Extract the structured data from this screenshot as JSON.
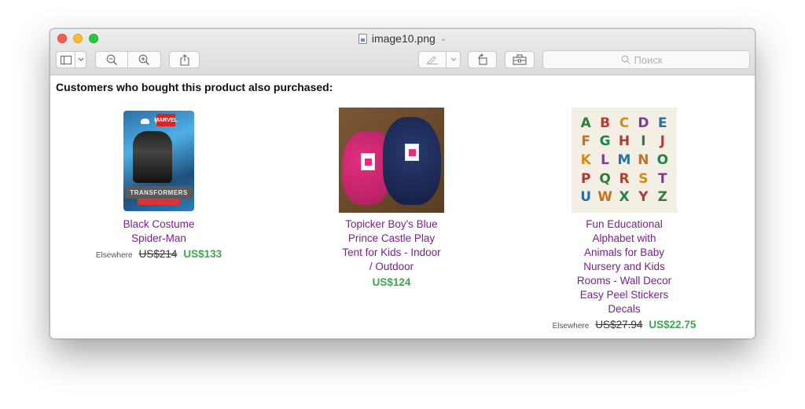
{
  "window": {
    "title": "image10.png"
  },
  "toolbar": {
    "search_placeholder": "Поиск"
  },
  "page": {
    "heading": "Customers who bought this product also purchased:"
  },
  "products": [
    {
      "name_lines": [
        "Black Costume",
        "Spider-Man"
      ],
      "elsewhere_label": "Elsewhere",
      "old_price": "US$214",
      "price": "US$133",
      "image_text": [
        "MARVEL",
        "TRANSFORMERS"
      ]
    },
    {
      "name_lines": [
        "Topicker Boy's Blue",
        "Prince Castle Play",
        "Tent for Kids - Indoor",
        "/ Outdoor"
      ],
      "price": "US$124"
    },
    {
      "name_lines": [
        "Fun Educational",
        "Alphabet with",
        "Animals for Baby",
        "Nursery and Kids",
        "Rooms - Wall Decor",
        "Easy Peel Stickers",
        "Decals"
      ],
      "elsewhere_label": "Elsewhere",
      "old_price": "US$27.94",
      "price": "US$22.75",
      "image_letters": [
        "A",
        "B",
        "C",
        "D",
        "E",
        "F",
        "G",
        "H",
        "I",
        "J",
        "K",
        "L",
        "M",
        "N",
        "O",
        "P",
        "Q",
        "R",
        "S",
        "T",
        "U",
        "W",
        "X",
        "Y",
        "Z"
      ]
    }
  ],
  "colors": {
    "link": "#7a1f8e",
    "price_green": "#3aa84a",
    "close": "#fd5f57",
    "minimize": "#febc2e",
    "maximize": "#28c840"
  },
  "icons": {
    "sidebar_toggle": "sidebar-icon",
    "zoom_out": "zoom-out-icon",
    "zoom_in": "zoom-in-icon",
    "share": "share-icon",
    "markup": "pen-icon",
    "rotate": "rotate-icon",
    "toolbox": "toolbox-icon",
    "search": "search-icon"
  }
}
